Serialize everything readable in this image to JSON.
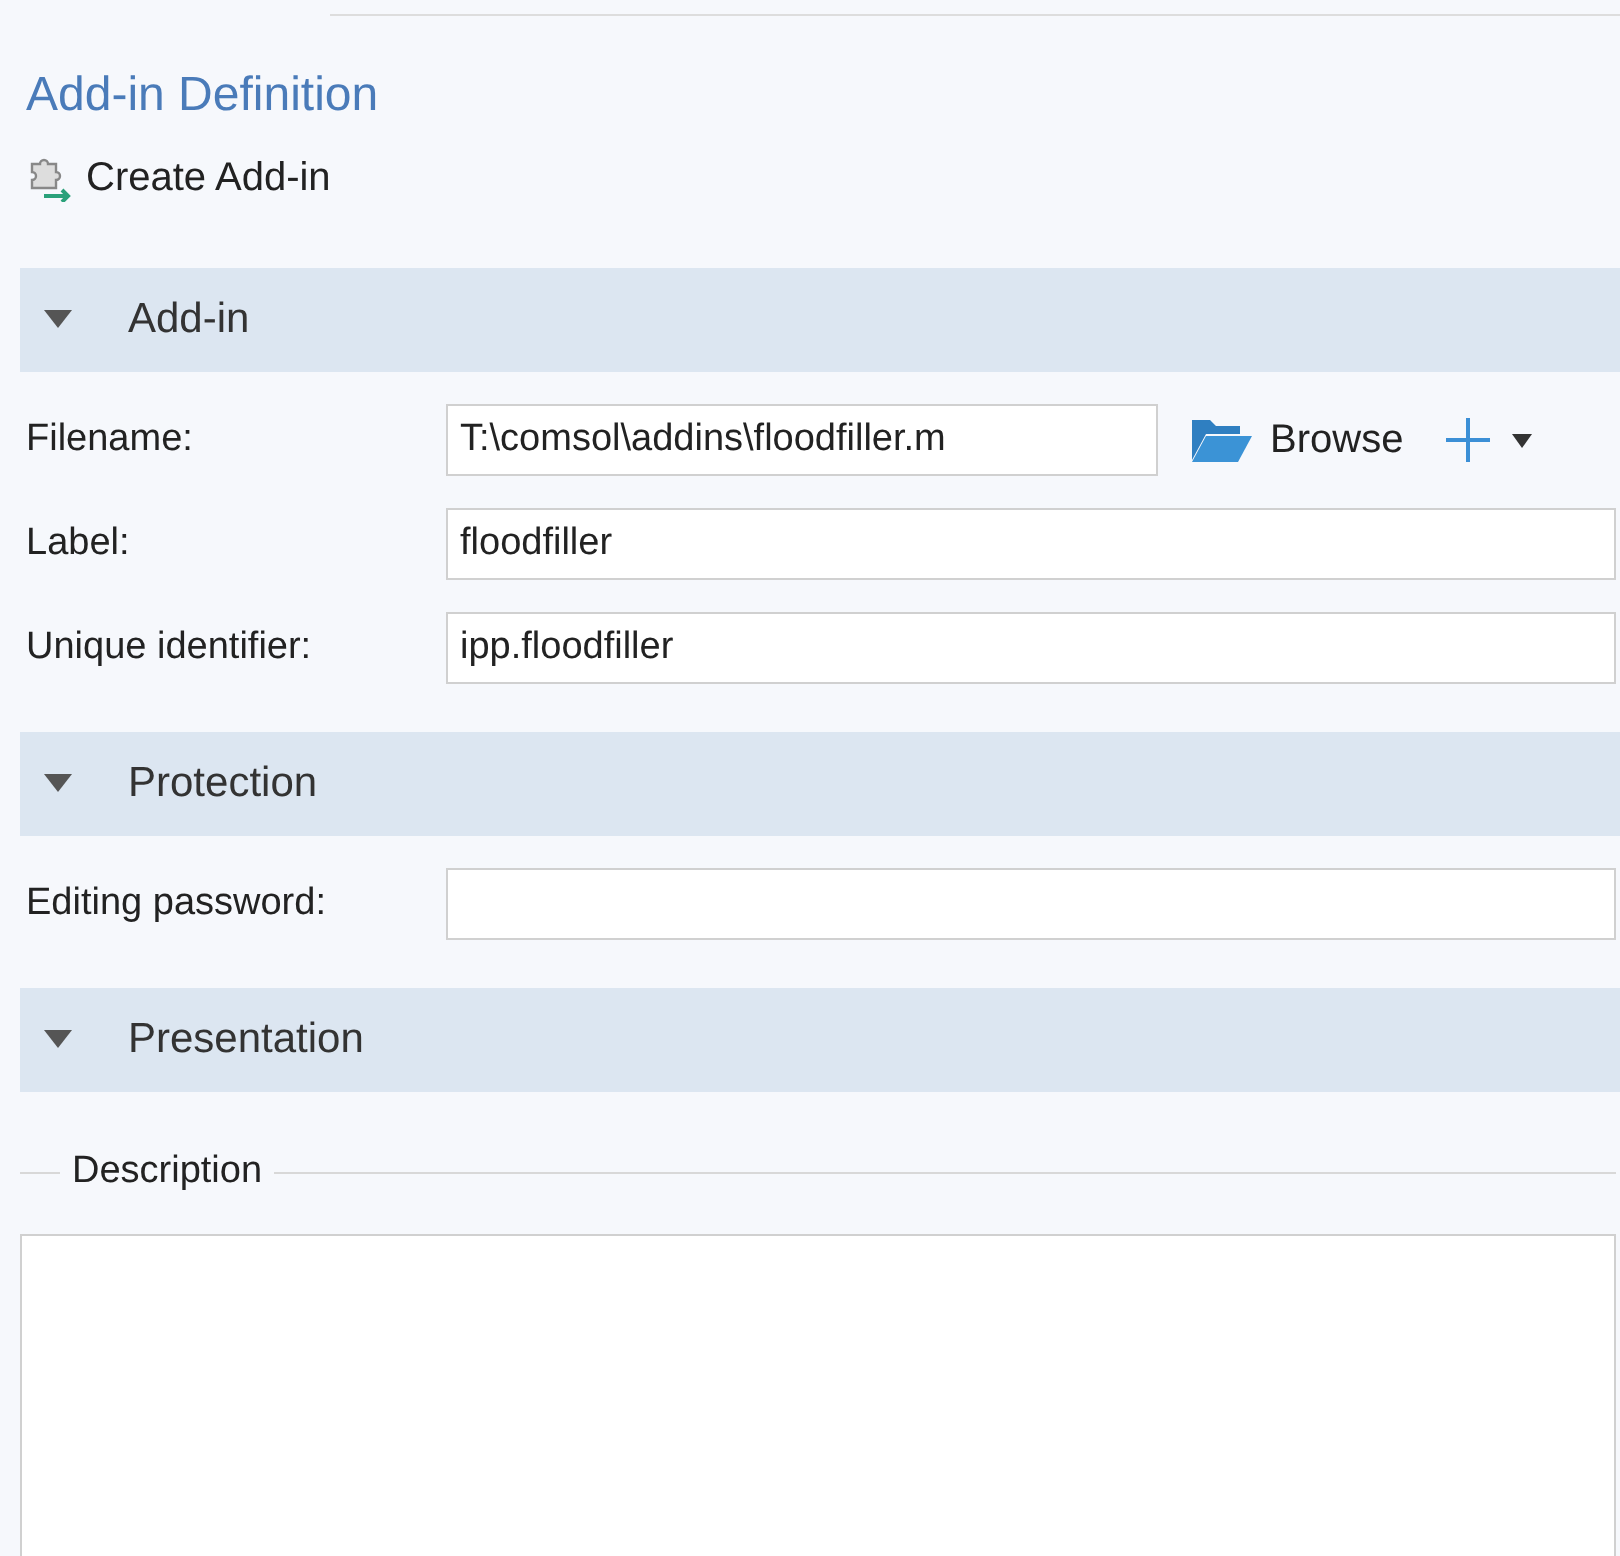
{
  "title": "Add-in Definition",
  "toolbar": [
    {
      "label": "Create Add-in"
    }
  ],
  "sections": [
    {
      "title": "Add-in",
      "expanded": true,
      "fields": [
        {
          "kind": "file",
          "label": "Filename:",
          "value": "T:\\comsol\\addins\\floodfiller.m",
          "browse": "Browse"
        },
        {
          "kind": "text",
          "label": "Label:",
          "value": "floodfiller"
        },
        {
          "kind": "text",
          "label": "Unique identifier:",
          "value": "ipp.floodfiller"
        }
      ]
    },
    {
      "title": "Protection",
      "expanded": true,
      "fields": [
        {
          "kind": "password",
          "label": "Editing password:"
        }
      ]
    },
    {
      "title": "Presentation",
      "expanded": true,
      "groups": [
        {
          "legend": "Description"
        }
      ]
    }
  ]
}
